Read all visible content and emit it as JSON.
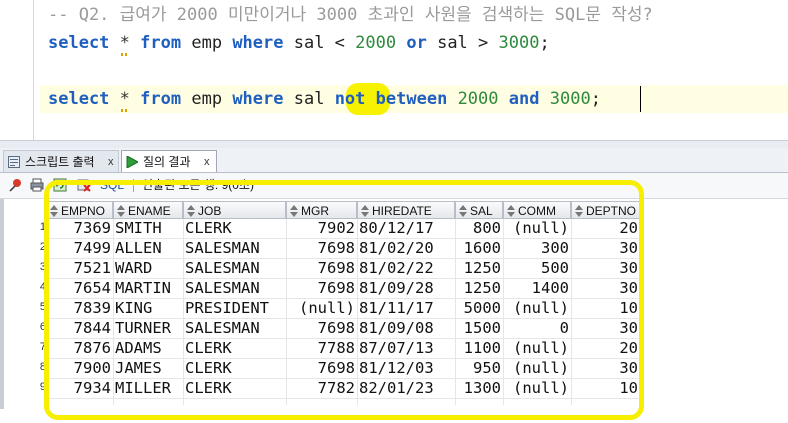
{
  "editor": {
    "comment": "-- Q2. 급여가 2000 미만이거나 3000 초과인 사원을 검색하는 SQL문 작성?",
    "line2": [
      {
        "t": "select",
        "c": "kw"
      },
      {
        "t": " ",
        "c": "id"
      },
      {
        "t": "*",
        "c": "star"
      },
      {
        "t": " ",
        "c": "id"
      },
      {
        "t": "from",
        "c": "kw"
      },
      {
        "t": " emp ",
        "c": "id"
      },
      {
        "t": "where",
        "c": "kw"
      },
      {
        "t": " sal < ",
        "c": "id"
      },
      {
        "t": "2000",
        "c": "num"
      },
      {
        "t": " ",
        "c": "id"
      },
      {
        "t": "or",
        "c": "kw"
      },
      {
        "t": " sal > ",
        "c": "id"
      },
      {
        "t": "3000",
        "c": "num"
      },
      {
        "t": ";",
        "c": "id"
      }
    ],
    "line3": [
      {
        "t": "select",
        "c": "kw"
      },
      {
        "t": " ",
        "c": "id"
      },
      {
        "t": "*",
        "c": "star"
      },
      {
        "t": " ",
        "c": "id"
      },
      {
        "t": "from",
        "c": "kw"
      },
      {
        "t": " emp ",
        "c": "id"
      },
      {
        "t": "where",
        "c": "kw"
      },
      {
        "t": " sal ",
        "c": "id"
      },
      {
        "t": "not",
        "c": "kw"
      },
      {
        "t": " ",
        "c": "id"
      },
      {
        "t": "between",
        "c": "kw"
      },
      {
        "t": " ",
        "c": "id"
      },
      {
        "t": "2000",
        "c": "num"
      },
      {
        "t": " ",
        "c": "id"
      },
      {
        "t": "and",
        "c": "kw"
      },
      {
        "t": " ",
        "c": "id"
      },
      {
        "t": "3000",
        "c": "num"
      },
      {
        "t": ";",
        "c": "id"
      }
    ]
  },
  "tabs": {
    "script_output": "스크립트 출력",
    "query_result": "질의 결과",
    "close": "x"
  },
  "toolbar": {
    "sql_label": "SQL",
    "status": "인출된 모든 행: 9(0초)",
    "icons": [
      "pin-icon",
      "print-icon",
      "refresh-icon",
      "sql-clear-icon"
    ]
  },
  "grid": {
    "columns": [
      "EMPNO",
      "ENAME",
      "JOB",
      "MGR",
      "HIREDATE",
      "SAL",
      "COMM",
      "DEPTNO"
    ],
    "rows": [
      [
        "7369",
        "SMITH",
        "CLERK",
        "7902",
        "80/12/17",
        "800",
        "(null)",
        "20"
      ],
      [
        "7499",
        "ALLEN",
        "SALESMAN",
        "7698",
        "81/02/20",
        "1600",
        "300",
        "30"
      ],
      [
        "7521",
        "WARD",
        "SALESMAN",
        "7698",
        "81/02/22",
        "1250",
        "500",
        "30"
      ],
      [
        "7654",
        "MARTIN",
        "SALESMAN",
        "7698",
        "81/09/28",
        "1250",
        "1400",
        "30"
      ],
      [
        "7839",
        "KING",
        "PRESIDENT",
        "(null)",
        "81/11/17",
        "5000",
        "(null)",
        "10"
      ],
      [
        "7844",
        "TURNER",
        "SALESMAN",
        "7698",
        "81/09/08",
        "1500",
        "0",
        "30"
      ],
      [
        "7876",
        "ADAMS",
        "CLERK",
        "7788",
        "87/07/13",
        "1100",
        "(null)",
        "20"
      ],
      [
        "7900",
        "JAMES",
        "CLERK",
        "7698",
        "81/12/03",
        "950",
        "(null)",
        "30"
      ],
      [
        "7934",
        "MILLER",
        "CLERK",
        "7782",
        "82/01/23",
        "1300",
        "(null)",
        "10"
      ]
    ]
  },
  "colors": {
    "keyword": "#1f5fbf",
    "number": "#2e8b3e",
    "highlight": "#f6f200"
  }
}
